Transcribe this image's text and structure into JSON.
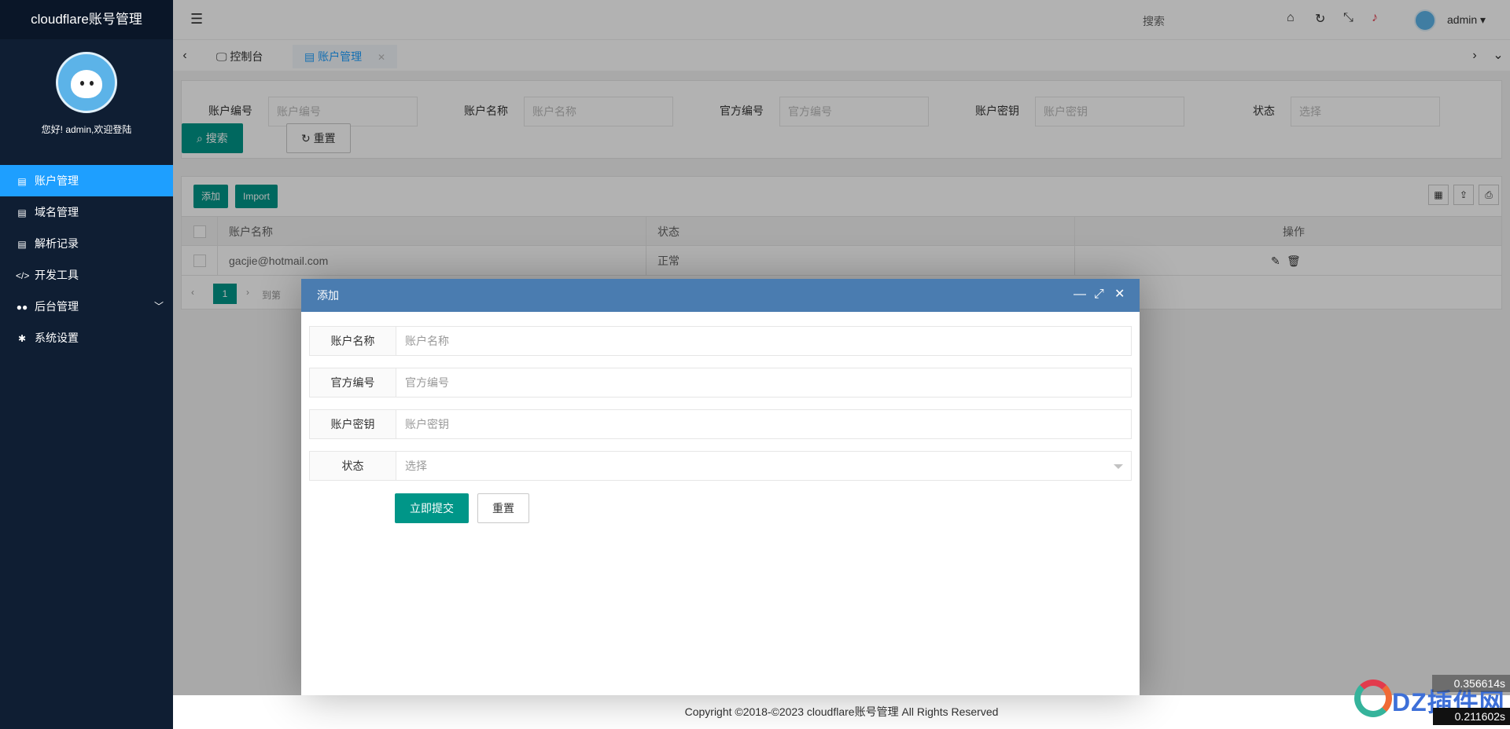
{
  "app": {
    "title": "cloudflare账号管理",
    "welcome": "您好! admin,欢迎登陆"
  },
  "sidebar": {
    "items": [
      {
        "label": "账户管理",
        "icon": "book-icon"
      },
      {
        "label": "域名管理",
        "icon": "book-icon"
      },
      {
        "label": "解析记录",
        "icon": "book-icon"
      },
      {
        "label": "开发工具",
        "icon": "code-icon"
      },
      {
        "label": "后台管理",
        "icon": "users-icon"
      },
      {
        "label": "系统设置",
        "icon": "gear-icon"
      }
    ]
  },
  "header": {
    "search": "搜索",
    "user": "admin"
  },
  "tabs": [
    {
      "label": "控制台"
    },
    {
      "label": "账户管理"
    }
  ],
  "filter": {
    "fields": [
      {
        "label": "账户编号",
        "placeholder": "账户编号"
      },
      {
        "label": "账户名称",
        "placeholder": "账户名称"
      },
      {
        "label": "官方编号",
        "placeholder": "官方编号"
      },
      {
        "label": "账户密钥",
        "placeholder": "账户密钥"
      },
      {
        "label": "状态",
        "placeholder": "选择"
      }
    ],
    "search_btn": "搜索",
    "reset_btn": "重置"
  },
  "table": {
    "add_btn": "添加",
    "import_btn": "Import",
    "columns": [
      "账户名称",
      "状态",
      "操作"
    ],
    "rows": [
      {
        "name": "gacjie@hotmail.com",
        "status": "正常"
      }
    ],
    "pager": {
      "page": "1",
      "goto": "到第"
    }
  },
  "dialog": {
    "title": "添加",
    "fields": [
      {
        "label": "账户名称",
        "placeholder": "账户名称"
      },
      {
        "label": "官方编号",
        "placeholder": "官方编号"
      },
      {
        "label": "账户密钥",
        "placeholder": "账户密钥"
      },
      {
        "label": "状态",
        "placeholder": "选择"
      }
    ],
    "submit_btn": "立即提交",
    "reset_btn": "重置"
  },
  "footer": {
    "text": "Copyright ©2018-©2023 cloudflare账号管理 All Rights Reserved"
  },
  "watermark": {
    "text": "DZ插件网",
    "time1": "0.356614s",
    "time2": "0.211602s"
  }
}
